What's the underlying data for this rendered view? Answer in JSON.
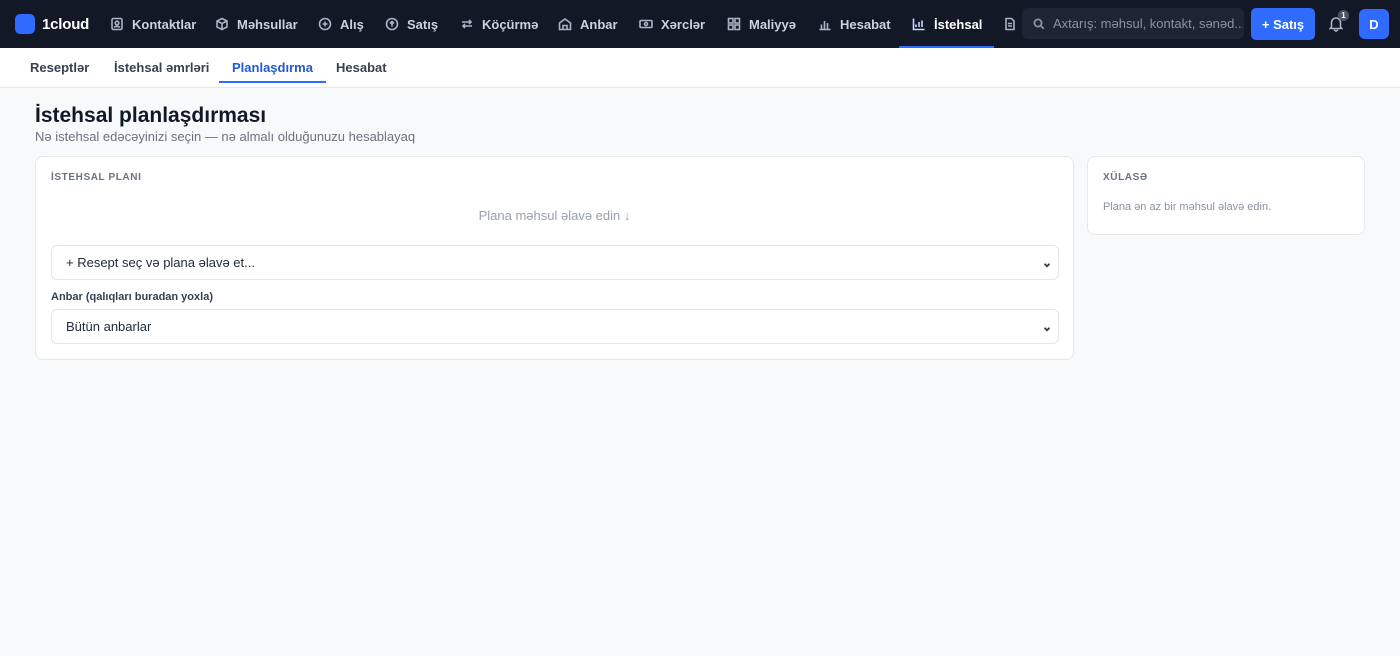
{
  "app": {
    "brand": "1cloud"
  },
  "nav": {
    "items": [
      {
        "label": "Kontaktlar",
        "icon": "contacts-icon"
      },
      {
        "label": "Məhsullar",
        "icon": "box-icon"
      },
      {
        "label": "Alış",
        "icon": "plus-circle-icon"
      },
      {
        "label": "Satış",
        "icon": "arrow-circle-icon"
      },
      {
        "label": "Köçürmə",
        "icon": "transfer-icon"
      },
      {
        "label": "Anbar",
        "icon": "warehouse-icon"
      },
      {
        "label": "Xərclər",
        "icon": "cash-icon"
      },
      {
        "label": "Maliyyə",
        "icon": "grid-icon"
      },
      {
        "label": "Hesabat",
        "icon": "bar-chart-icon"
      },
      {
        "label": "İstehsal",
        "icon": "production-chart-icon",
        "active": true
      }
    ],
    "search_placeholder": "Axtarış: məhsul, kontakt, sənəd...",
    "sale_button": "+ Satış",
    "notification_count": "1",
    "avatar_initial": "D",
    "accent": "#2f6bff",
    "background": "#121826"
  },
  "subtabs": {
    "items": [
      {
        "label": "Reseptlər"
      },
      {
        "label": "İstehsal əmrləri"
      },
      {
        "label": "Planlaşdırma",
        "active": true
      },
      {
        "label": "Hesabat"
      }
    ]
  },
  "page": {
    "title": "İstehsal planlaşdırması",
    "subtitle": "Nə istehsal edəcəyinizi seçin — nə almalı olduğunuzu hesablayaq"
  },
  "plan": {
    "section_title": "İSTEHSAL PLANI",
    "empty_hint": "Plana məhsul əlavə edin ↓",
    "recipe_select": "+ Resept seç və plana əlavə et...",
    "warehouse_label": "Anbar (qalıqları buradan yoxla)",
    "warehouse_select": "Bütün anbarlar"
  },
  "summary": {
    "section_title": "XÜLASƏ",
    "note": "Plana ən az bir məhsul əlavə edin."
  }
}
